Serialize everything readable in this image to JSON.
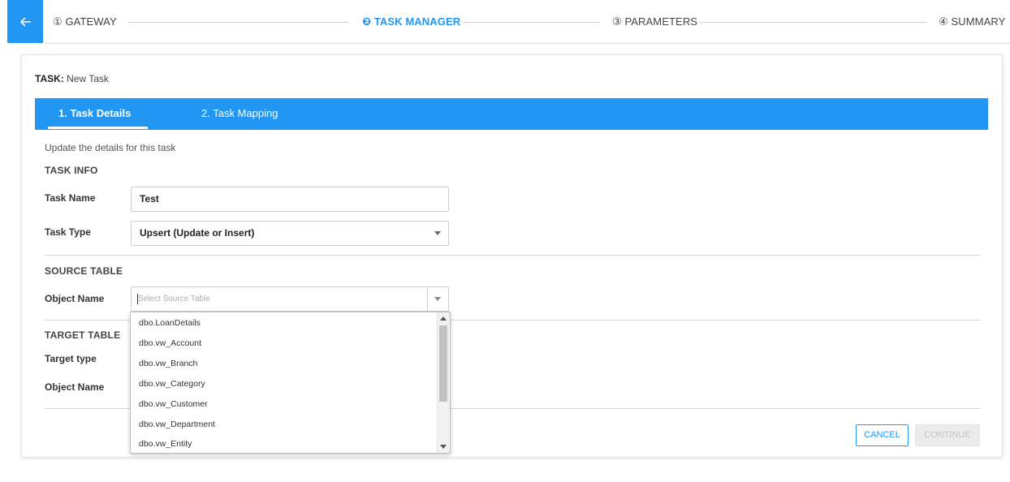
{
  "stepper": {
    "steps": [
      {
        "label": "① GATEWAY"
      },
      {
        "label": "❷ TASK MANAGER"
      },
      {
        "label": "③ PARAMETERS"
      },
      {
        "label": "④ SUMMARY"
      }
    ],
    "active_index": 1
  },
  "task": {
    "prefix": "TASK:",
    "name": "New Task"
  },
  "tabs": [
    {
      "label": "1. Task Details"
    },
    {
      "label": "2. Task Mapping"
    }
  ],
  "subtitle": "Update the details for this task",
  "task_info": {
    "heading": "TASK INFO",
    "task_name_label": "Task Name",
    "task_name_value": "Test",
    "task_type_label": "Task Type",
    "task_type_value": "Upsert (Update or Insert)"
  },
  "source_table": {
    "heading": "SOURCE TABLE",
    "object_name_label": "Object Name",
    "placeholder": "Select Source Table"
  },
  "target_table": {
    "heading": "TARGET TABLE",
    "target_type_label": "Target type",
    "object_name_label": "Object Name"
  },
  "dropdown_options": [
    "dbo.LoanDetails",
    "dbo.vw_Account",
    "dbo.vw_Branch",
    "dbo.vw_Category",
    "dbo.vw_Customer",
    "dbo.vw_Department",
    "dbo.vw_Entity"
  ],
  "buttons": {
    "cancel": "CANCEL",
    "continue": "CONTINUE"
  },
  "colors": {
    "accent": "#2196f3",
    "disabled": "#ececec"
  }
}
